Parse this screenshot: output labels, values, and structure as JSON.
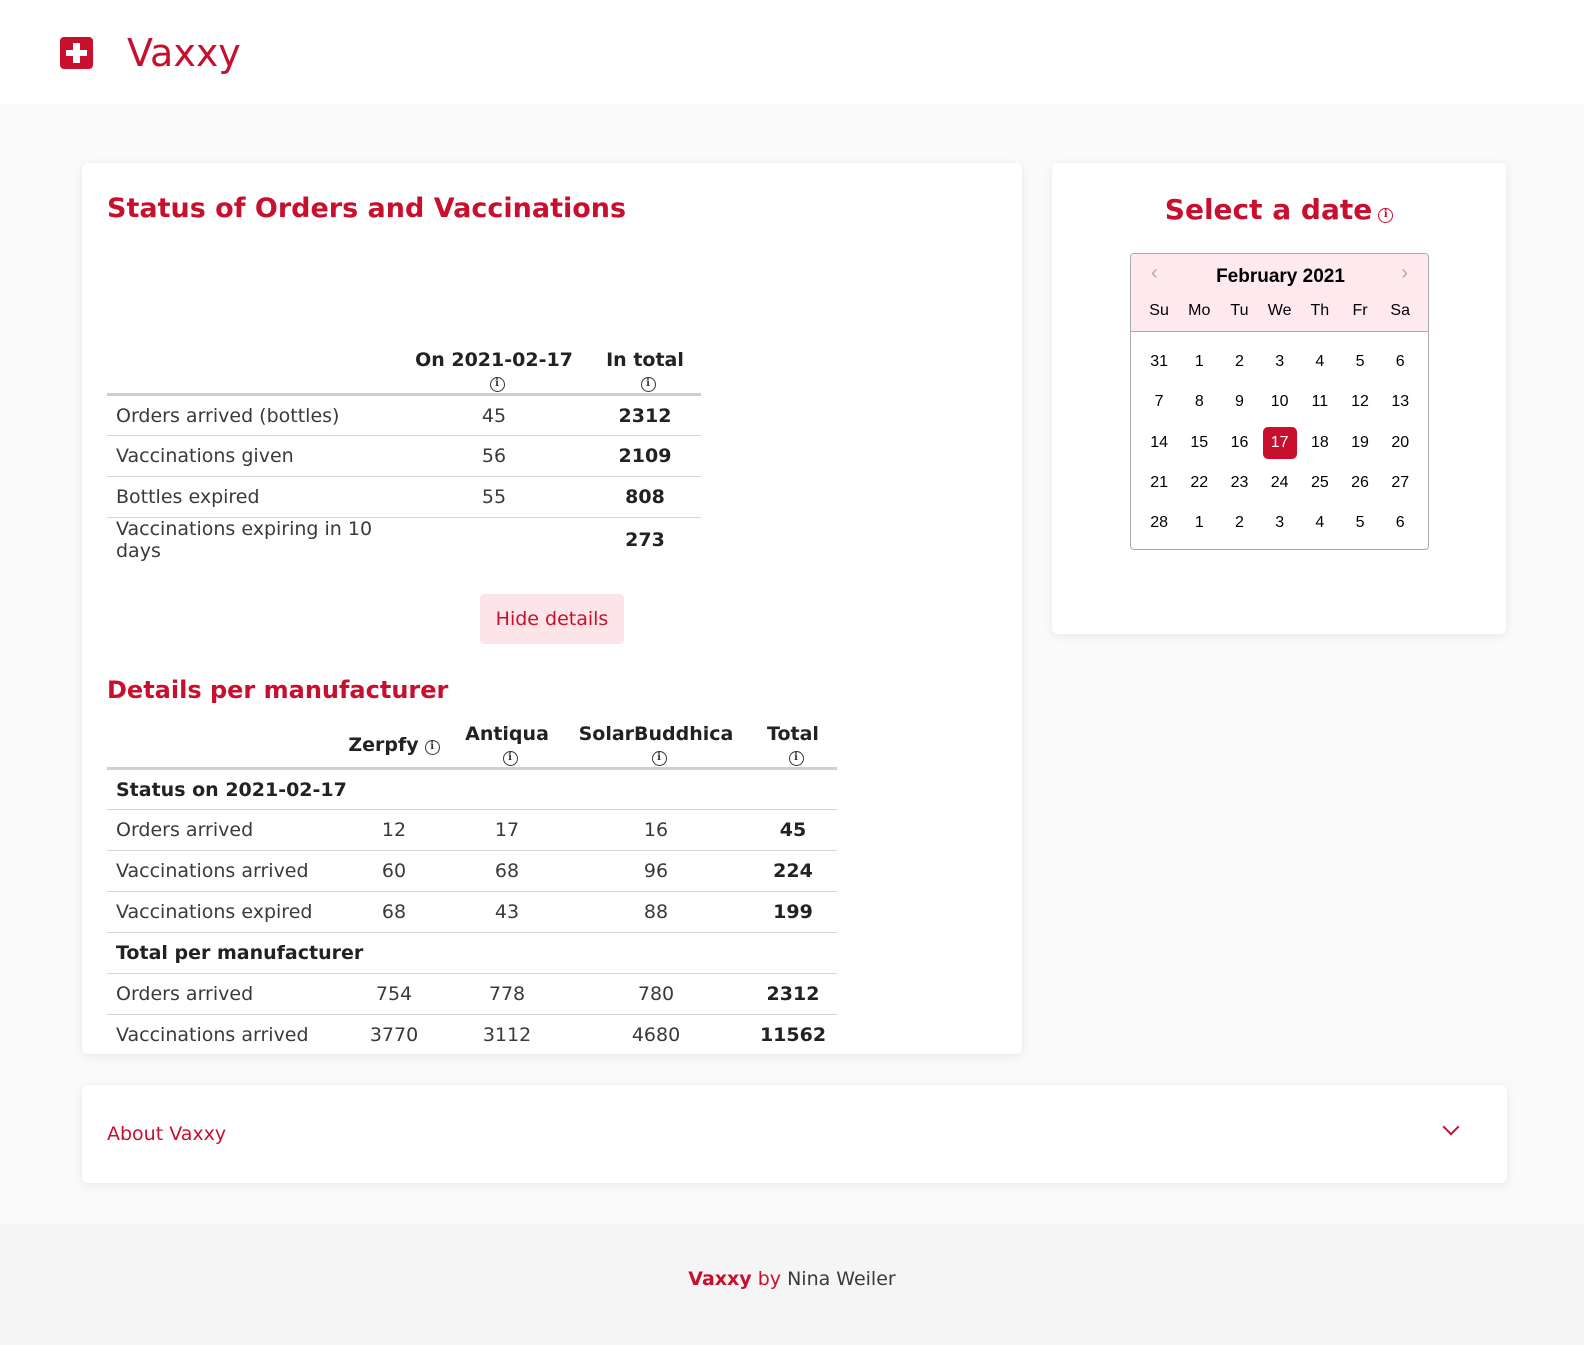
{
  "header": {
    "brand": "Vaxxy"
  },
  "status": {
    "title": "Status of Orders and Vaccinations",
    "summary_headers": [
      "",
      "On 2021-02-17",
      "In total"
    ],
    "summary_rows": [
      {
        "label": "Orders arrived (bottles)",
        "day": "45",
        "total": "2312"
      },
      {
        "label": "Vaccinations given",
        "day": "56",
        "total": "2109"
      },
      {
        "label": "Bottles expired",
        "day": "55",
        "total": "808"
      },
      {
        "label": "Vaccinations expiring in 10 days",
        "day": "",
        "total": "273"
      }
    ],
    "hide_button": "Hide details",
    "details_title": "Details per manufacturer",
    "details_headers": [
      "",
      "Zerpfy",
      "Antiqua",
      "SolarBuddhica",
      "Total"
    ],
    "section_day": "Status on 2021-02-17",
    "day_rows": [
      {
        "label": "Orders arrived",
        "zerpfy": "12",
        "antiqua": "17",
        "solar": "16",
        "total": "45"
      },
      {
        "label": "Vaccinations arrived",
        "zerpfy": "60",
        "antiqua": "68",
        "solar": "96",
        "total": "224"
      },
      {
        "label": "Vaccinations expired",
        "zerpfy": "68",
        "antiqua": "43",
        "solar": "88",
        "total": "199"
      }
    ],
    "section_total": "Total per manufacturer",
    "total_rows": [
      {
        "label": "Orders arrived",
        "zerpfy": "754",
        "antiqua": "778",
        "solar": "780",
        "total": "2312"
      },
      {
        "label": "Vaccinations arrived",
        "zerpfy": "3770",
        "antiqua": "3112",
        "solar": "4680",
        "total": "11562"
      }
    ]
  },
  "date_picker": {
    "title": "Select a date",
    "month": "February 2021",
    "weekdays": [
      "Su",
      "Mo",
      "Tu",
      "We",
      "Th",
      "Fr",
      "Sa"
    ],
    "days": [
      "31",
      "1",
      "2",
      "3",
      "4",
      "5",
      "6",
      "7",
      "8",
      "9",
      "10",
      "11",
      "12",
      "13",
      "14",
      "15",
      "16",
      "17",
      "18",
      "19",
      "20",
      "21",
      "22",
      "23",
      "24",
      "25",
      "26",
      "27",
      "28",
      "1",
      "2",
      "3",
      "4",
      "5",
      "6"
    ],
    "selected": "17"
  },
  "about": {
    "title": "About Vaxxy"
  },
  "footer": {
    "brand": "Vaxxy",
    "by": "by",
    "author": "Nina Weiler"
  },
  "colors": {
    "accent": "#c8102e",
    "button_bg": "#fde4e9",
    "calendar_header": "#fde9ee"
  }
}
